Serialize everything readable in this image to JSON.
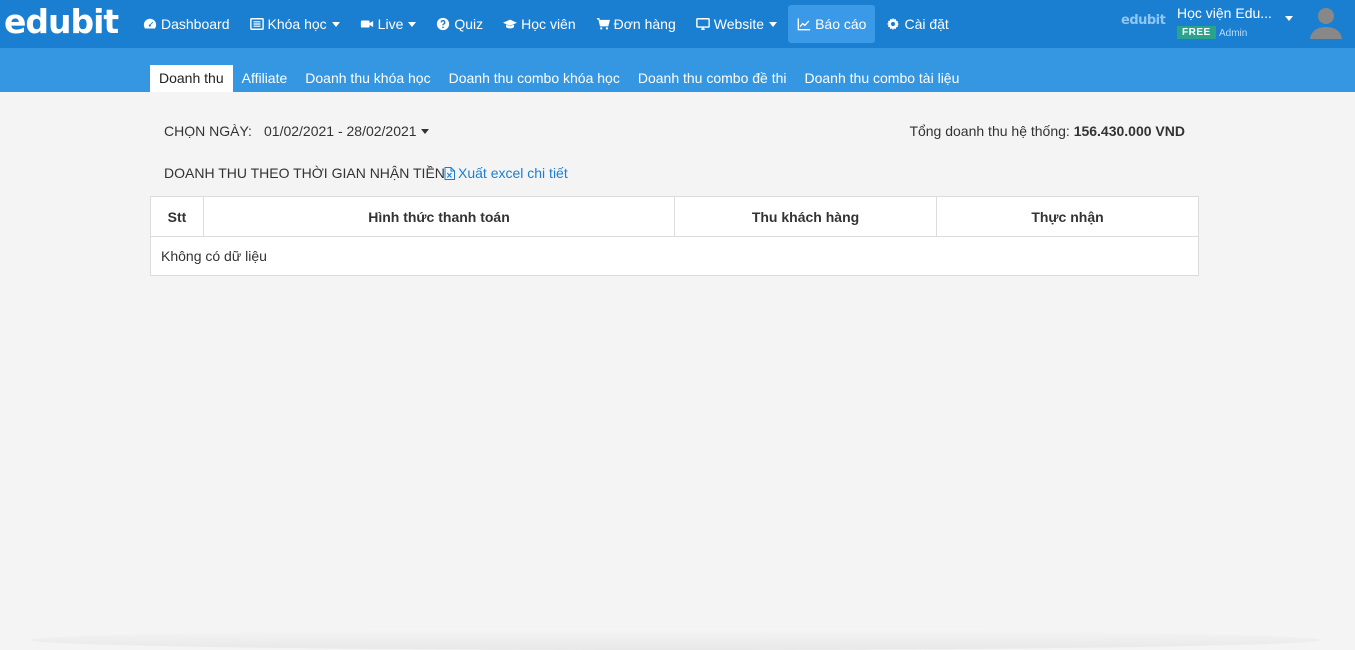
{
  "app": {
    "logo_text": "edubit",
    "mini_logo_text": "edubit"
  },
  "nav": {
    "items": [
      {
        "label": "Dashboard",
        "icon": "dashboard-icon",
        "has_caret": false,
        "active": false
      },
      {
        "label": "Khóa học",
        "icon": "list-icon",
        "has_caret": true,
        "active": false
      },
      {
        "label": "Live",
        "icon": "video-camera-icon",
        "has_caret": true,
        "active": false
      },
      {
        "label": "Quiz",
        "icon": "question-circle-icon",
        "has_caret": false,
        "active": false
      },
      {
        "label": "Học viên",
        "icon": "graduation-cap-icon",
        "has_caret": false,
        "active": false
      },
      {
        "label": "Đơn hàng",
        "icon": "shopping-cart-icon",
        "has_caret": false,
        "active": false
      },
      {
        "label": "Website",
        "icon": "desktop-icon",
        "has_caret": true,
        "active": false
      },
      {
        "label": "Báo cáo",
        "icon": "line-chart-icon",
        "has_caret": false,
        "active": true
      },
      {
        "label": "Cài đặt",
        "icon": "gear-icon",
        "has_caret": false,
        "active": false
      }
    ]
  },
  "user": {
    "name": "Học viện Edu...",
    "plan": "FREE",
    "role": "Admin"
  },
  "subtabs": [
    {
      "label": "Doanh thu",
      "active": true
    },
    {
      "label": "Affiliate",
      "active": false
    },
    {
      "label": "Doanh thu khóa học",
      "active": false
    },
    {
      "label": "Doanh thu combo khóa học",
      "active": false
    },
    {
      "label": "Doanh thu combo đề thi",
      "active": false
    },
    {
      "label": "Doanh thu combo tài liệu",
      "active": false
    }
  ],
  "filter": {
    "label": "CHỌN NGÀY:",
    "date_range": "01/02/2021 - 28/02/2021"
  },
  "summary": {
    "total_label": "Tổng doanh thu hệ thống:",
    "total_value": "156.430.000 VND"
  },
  "section": {
    "title": "DOANH THU THEO THỜI GIAN NHẬN TIỀN",
    "export_label": "Xuất excel chi tiết"
  },
  "table": {
    "columns": [
      "Stt",
      "Hình thức thanh toán",
      "Thu khách hàng",
      "Thực nhận"
    ],
    "empty_text": "Không có dữ liệu"
  },
  "colors": {
    "topbar": "#1b7fd1",
    "subbar": "#3596e1",
    "active_nav": "#3b9ae8",
    "link": "#1b7fd1",
    "plan_badge": "#29a38c"
  }
}
